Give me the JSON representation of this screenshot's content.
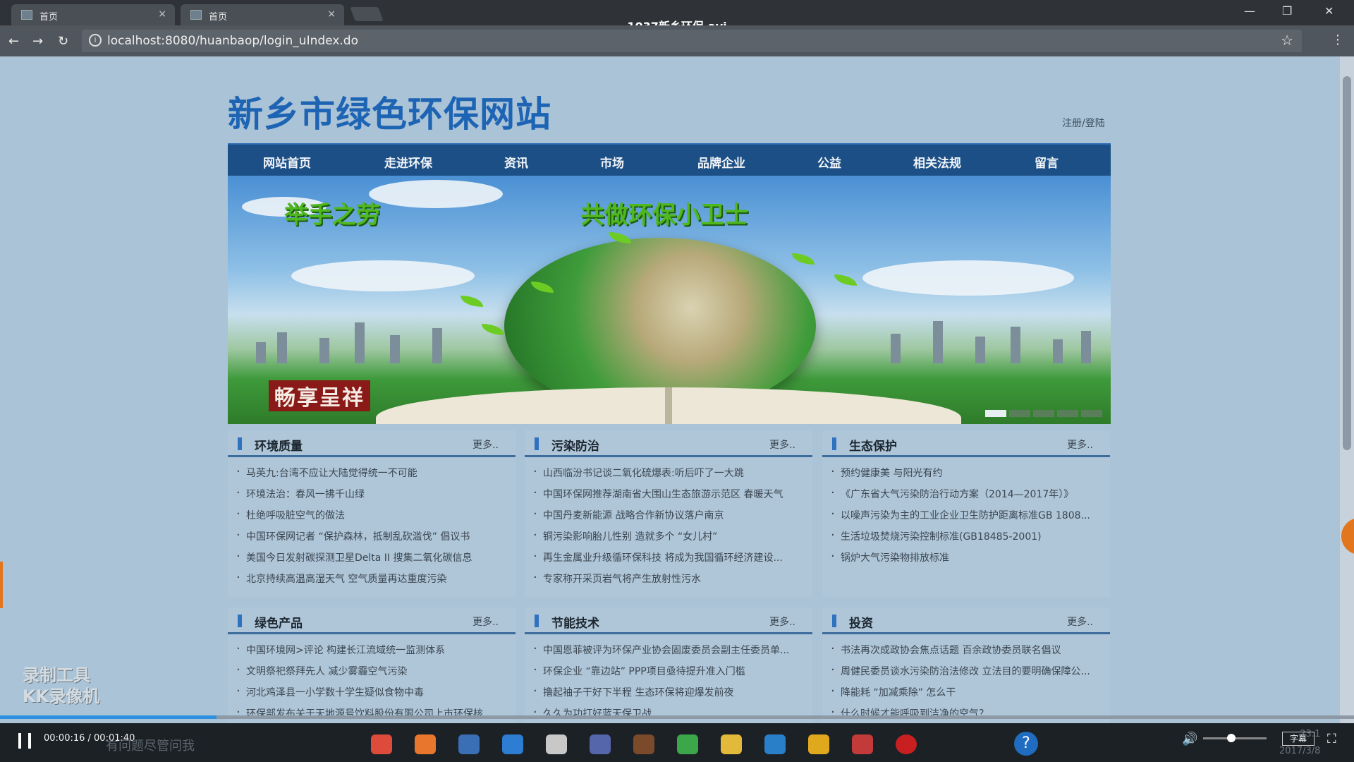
{
  "browser": {
    "tabs": [
      {
        "title": "首页"
      },
      {
        "title": "首页"
      }
    ],
    "video_title": "1037新乡环保.avi",
    "url": "localhost:8080/huanbaop/login_uIndex.do"
  },
  "site": {
    "title": "新乡市绿色环保网站",
    "login_link": "注册/登陆",
    "nav": [
      "网站首页",
      "走进环保",
      "资讯",
      "市场",
      "品牌企业",
      "公益",
      "相关法规",
      "留言"
    ],
    "banner": {
      "slogan_left": "举手之劳",
      "slogan_right": "共做环保小卫士",
      "brand_text": "畅享呈祥",
      "slide_count": 5,
      "active_slide": 1
    },
    "panels": [
      {
        "title": "环境质量",
        "more": "更多..",
        "items": [
          "马英九:台湾不应让大陆觉得统一不可能",
          "环境法治：春风一拂千山绿",
          "杜绝呼吸脏空气的做法",
          "中国环保网记者 “保护森林，抵制乱砍滥伐” 倡议书",
          "美国今日发射碳探测卫星Delta II 搜集二氧化碳信息",
          "北京持续高温高湿天气 空气质量再达重度污染"
        ]
      },
      {
        "title": "污染防治",
        "more": "更多..",
        "items": [
          "山西临汾书记谈二氧化硫爆表:听后吓了一大跳",
          "中国环保网推荐湖南省大围山生态旅游示范区 春暖天气",
          "中国丹麦新能源 战略合作新协议落户南京",
          "铜污染影响胎儿性别 造就多个 “女儿村”",
          "再生金属业升级循环保科技 将成为我国循环经济建设...",
          "专家称开采页岩气将产生放射性污水"
        ]
      },
      {
        "title": "生态保护",
        "more": "更多..",
        "items": [
          "预约健康美 与阳光有约",
          "《广东省大气污染防治行动方案（2014—2017年）》",
          "以噪声污染为主的工业企业卫生防护距离标准GB 1808...",
          "生活垃圾焚烧污染控制标准(GB18485-2001)",
          "锅炉大气污染物排放标准"
        ]
      },
      {
        "title": "绿色产品",
        "more": "更多..",
        "items": [
          "中国环境网>评论 构建长江流域统一监测体系",
          "文明祭祀祭拜先人 减少雾霾空气污染",
          "河北鸡泽县一小学数十学生疑似食物中毒",
          "环保部发布关于天地源号饮料股份有限公司上市环保核..."
        ]
      },
      {
        "title": "节能技术",
        "more": "更多..",
        "items": [
          "中国恩菲被评为环保产业协会固废委员会副主任委员单...",
          "环保企业 “靠边站” PPP项目亟待提升准入门槛",
          "撸起袖子干好下半程 生态环保将迎爆发前夜",
          "久久为功打好蓝天保卫战"
        ]
      },
      {
        "title": "投资",
        "more": "更多..",
        "items": [
          "书法再次成政协会焦点话题 百余政协委员联名倡议",
          "周健民委员谈水污染防治法修改 立法目的要明确保障公...",
          "降能耗 “加减乘除” 怎么干",
          "什么时候才能呼吸到洁净的空气？"
        ]
      }
    ],
    "watermark": [
      "录制工具",
      "KK录像机"
    ]
  },
  "player": {
    "time": "00:00:16 / 00:01:40",
    "progress": 0.16,
    "search_placeholder": "有问题尽管问我",
    "subtitle_button": "字幕",
    "clock_time": "23:1",
    "clock_date": "2017/3/8"
  }
}
